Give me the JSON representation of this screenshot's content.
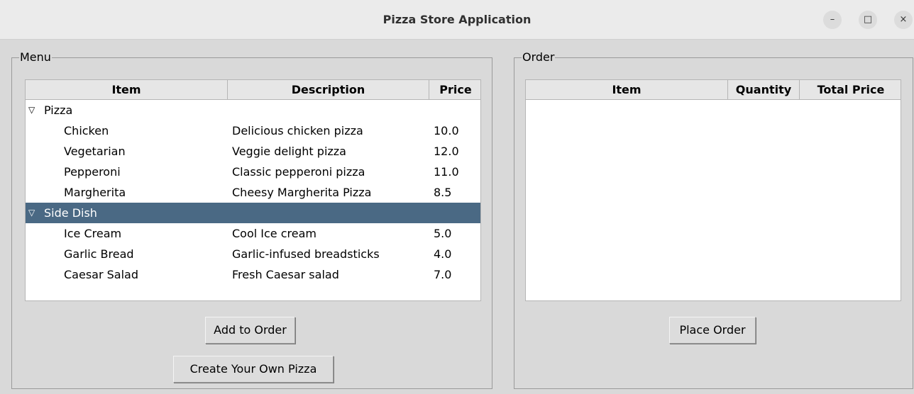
{
  "window": {
    "title": "Pizza Store Application",
    "minimize_glyph": "–",
    "maximize_glyph": "□",
    "close_glyph": "×"
  },
  "menu": {
    "frame_label": "Menu",
    "columns": [
      "Item",
      "Description",
      "Price"
    ],
    "groups": [
      {
        "name": "Pizza",
        "expanded": true,
        "selected": false,
        "items": [
          {
            "item": "Chicken",
            "description": "Delicious chicken pizza",
            "price": "10.0"
          },
          {
            "item": "Vegetarian",
            "description": "Veggie delight pizza",
            "price": "12.0"
          },
          {
            "item": "Pepperoni",
            "description": "Classic pepperoni pizza",
            "price": "11.0"
          },
          {
            "item": "Margherita",
            "description": "Cheesy Margherita Pizza",
            "price": "8.5"
          }
        ]
      },
      {
        "name": "Side Dish",
        "expanded": true,
        "selected": true,
        "items": [
          {
            "item": "Ice Cream",
            "description": "Cool Ice cream",
            "price": "5.0"
          },
          {
            "item": "Garlic Bread",
            "description": "Garlic-infused breadsticks",
            "price": "4.0"
          },
          {
            "item": "Caesar Salad",
            "description": "Fresh Caesar salad",
            "price": "7.0"
          }
        ]
      }
    ],
    "add_button": "Add to Order",
    "create_button": "Create Your Own Pizza"
  },
  "order": {
    "frame_label": "Order",
    "columns": [
      "Item",
      "Quantity",
      "Total Price"
    ],
    "rows": [],
    "place_button": "Place Order"
  },
  "colors": {
    "selection": "#4a6984",
    "background": "#d9d9d9"
  }
}
